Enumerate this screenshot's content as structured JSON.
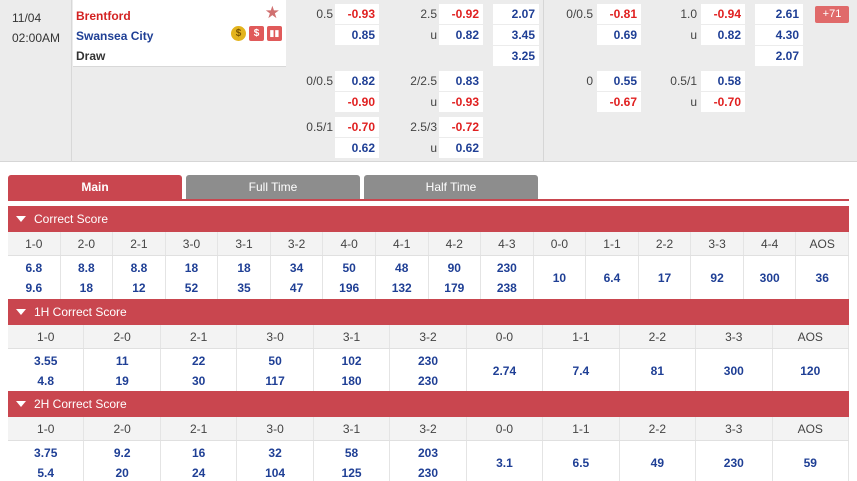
{
  "match": {
    "date": "11/04",
    "time": "02:00AM",
    "home_team": "Brentford",
    "away_team": "Swansea City",
    "draw_label": "Draw",
    "more_count": "+71",
    "icons": [
      "favorite-star-icon",
      "coin-icon",
      "dollar-icon",
      "chart-icon"
    ],
    "full_time": {
      "rows": [
        {
          "hdp": "0.5",
          "hdp_home": "-0.93",
          "hdp_away": "0.85",
          "ou_line": "2.5",
          "ou_under_label": "u",
          "ou_over": "-0.92",
          "ou_under": "0.82",
          "x1": "2.07",
          "x2": "3.45",
          "x3": "3.25"
        },
        {
          "hdp": "0/0.5",
          "hdp_home": "0.82",
          "hdp_away": "-0.90",
          "ou_line": "2/2.5",
          "ou_under_label": "u",
          "ou_over": "0.83",
          "ou_under": "-0.93"
        },
        {
          "hdp": "0.5/1",
          "hdp_home": "-0.70",
          "hdp_away": "0.62",
          "ou_line": "2.5/3",
          "ou_under_label": "u",
          "ou_over": "-0.72",
          "ou_under": "0.62"
        }
      ]
    },
    "first_half": {
      "rows": [
        {
          "hdp": "0/0.5",
          "hdp_home": "-0.81",
          "hdp_away": "0.69",
          "ou_line": "1.0",
          "ou_under_label": "u",
          "ou_over": "-0.94",
          "ou_under": "0.82",
          "x1": "2.61",
          "x2": "4.30",
          "x3": "2.07"
        },
        {
          "hdp": "0",
          "hdp_home": "0.55",
          "hdp_away": "-0.67",
          "ou_line": "0.5/1",
          "ou_under_label": "u",
          "ou_over": "0.58",
          "ou_under": "-0.70"
        }
      ]
    }
  },
  "tabs": [
    {
      "label": "Main",
      "active": true
    },
    {
      "label": "Full Time",
      "active": false
    },
    {
      "label": "Half Time",
      "active": false
    }
  ],
  "sections": [
    {
      "title": "Correct Score",
      "headers": [
        "1-0",
        "2-0",
        "2-1",
        "3-0",
        "3-1",
        "3-2",
        "4-0",
        "4-1",
        "4-2",
        "4-3",
        "0-0",
        "1-1",
        "2-2",
        "3-3",
        "4-4",
        "AOS"
      ],
      "values": [
        [
          "6.8",
          "9.6"
        ],
        [
          "8.8",
          "18"
        ],
        [
          "8.8",
          "12"
        ],
        [
          "18",
          "52"
        ],
        [
          "18",
          "35"
        ],
        [
          "34",
          "47"
        ],
        [
          "50",
          "196"
        ],
        [
          "48",
          "132"
        ],
        [
          "90",
          "179"
        ],
        [
          "230",
          "238"
        ],
        [
          "10"
        ],
        [
          "6.4"
        ],
        [
          "17"
        ],
        [
          "92"
        ],
        [
          "300"
        ],
        [
          "36"
        ]
      ]
    },
    {
      "title": "1H Correct Score",
      "headers": [
        "1-0",
        "2-0",
        "2-1",
        "3-0",
        "3-1",
        "3-2",
        "0-0",
        "1-1",
        "2-2",
        "3-3",
        "AOS"
      ],
      "values": [
        [
          "3.55",
          "4.8"
        ],
        [
          "11",
          "19"
        ],
        [
          "22",
          "30"
        ],
        [
          "50",
          "117"
        ],
        [
          "102",
          "180"
        ],
        [
          "230",
          "230"
        ],
        [
          "2.74"
        ],
        [
          "7.4"
        ],
        [
          "81"
        ],
        [
          "300"
        ],
        [
          "120"
        ]
      ]
    },
    {
      "title": "2H Correct Score",
      "headers": [
        "1-0",
        "2-0",
        "2-1",
        "3-0",
        "3-1",
        "3-2",
        "0-0",
        "1-1",
        "2-2",
        "3-3",
        "AOS"
      ],
      "values": [
        [
          "3.75",
          "5.4"
        ],
        [
          "9.2",
          "20"
        ],
        [
          "16",
          "24"
        ],
        [
          "32",
          "104"
        ],
        [
          "58",
          "125"
        ],
        [
          "203",
          "230"
        ],
        [
          "3.1"
        ],
        [
          "6.5"
        ],
        [
          "49"
        ],
        [
          "230"
        ],
        [
          "59"
        ]
      ]
    }
  ]
}
